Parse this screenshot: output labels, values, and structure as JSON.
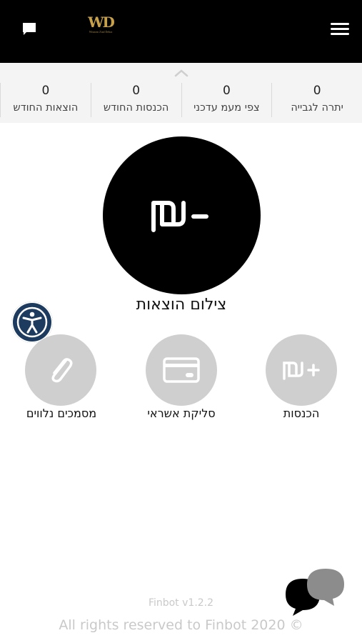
{
  "header": {
    "logo_mark": "WD",
    "logo_subtitle": "Wisnom Ziad Debra",
    "chat_icon": "chat-icon",
    "menu_icon": "hamburger-menu-icon",
    "background": "#000000"
  },
  "stats": [
    {
      "label": "יתרה לגבייה",
      "value": "0"
    },
    {
      "label": "צפי מעמ עדכני",
      "value": "0"
    },
    {
      "label": "הכנסות החודש",
      "value": "0"
    },
    {
      "label": "הוצאות החודש",
      "value": "0"
    }
  ],
  "main_action": {
    "label": "צילום הוצאות",
    "icon": "shekel-minus-icon"
  },
  "actions": [
    {
      "label": "הכנסות",
      "icon": "shekel-plus-icon"
    },
    {
      "label": "סליקת אשראי",
      "icon": "credit-card-icon"
    },
    {
      "label": "מסמכים נלווים",
      "icon": "paperclip-icon"
    }
  ],
  "accessibility_icon": "accessibility-icon",
  "footer": {
    "version": "Finbot v1.2.2",
    "copyright": "All rights reserved to Finbot 2020 ©"
  },
  "colors": {
    "accent_gold": "#c8a24a",
    "action_gray": "#cfcfcf",
    "accessibility_blue": "#1c3b5e"
  }
}
